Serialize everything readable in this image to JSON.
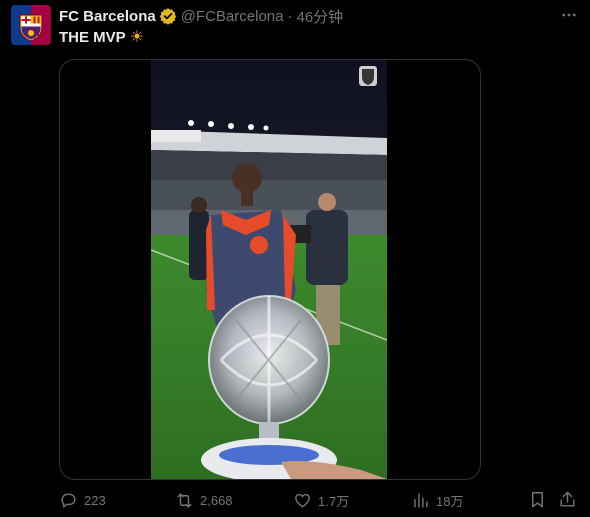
{
  "tweet": {
    "author_name": "FC Barcelona",
    "handle": "@FCBarcelona",
    "separator": "·",
    "time": "46分钟",
    "text": "THE MVP",
    "emoji": "☀"
  },
  "stats": {
    "replies": "223",
    "reposts": "2,668",
    "likes": "1.7万",
    "views": "18万"
  },
  "colors": {
    "background": "#000000",
    "text_primary": "#e7e9ea",
    "text_secondary": "#71767b",
    "verified_gold": "#e2b719",
    "border": "#2f3336"
  },
  "icons": {
    "verified": "verified-badge-icon",
    "more": "more-dots-icon",
    "reply": "reply-icon",
    "repost": "repost-icon",
    "like": "heart-icon",
    "views": "views-icon",
    "bookmark": "bookmark-icon",
    "share": "share-icon"
  }
}
